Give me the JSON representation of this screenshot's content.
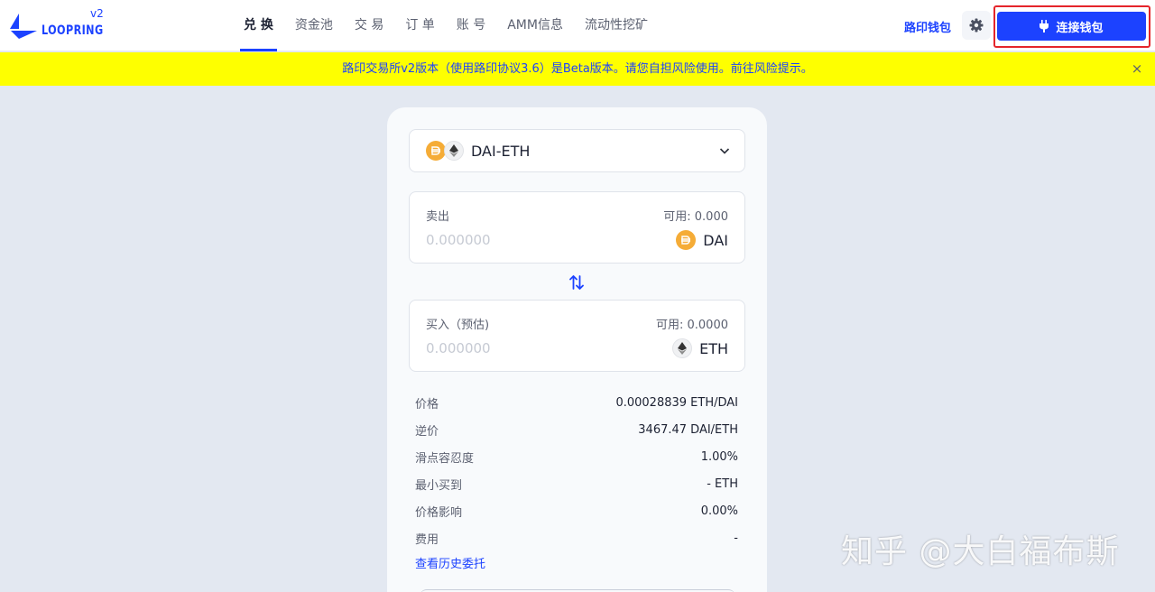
{
  "header": {
    "logo_text": "LOOPRING",
    "version": "v2",
    "nav": [
      {
        "label": "兑 换",
        "active": true
      },
      {
        "label": "资金池",
        "active": false
      },
      {
        "label": "交 易",
        "active": false
      },
      {
        "label": "订 单",
        "active": false
      },
      {
        "label": "账 号",
        "active": false
      },
      {
        "label": "AMM信息",
        "active": false
      },
      {
        "label": "流动性挖矿",
        "active": false
      }
    ],
    "wallet_link": "路印钱包",
    "settings_icon": "gear-icon",
    "connect_button": "连接钱包",
    "connect_icon": "plug-icon"
  },
  "banner": {
    "text": "路印交易所v2版本（使用路印协议3.6）是Beta版本。请您自担风险使用。前往风险提示。",
    "close": "×"
  },
  "swap": {
    "pair": "DAI-ETH",
    "sell": {
      "label": "卖出",
      "available": "可用: 0.000",
      "amount_placeholder": "0.000000",
      "token": "DAI"
    },
    "buy": {
      "label": "买入（预估)",
      "available": "可用: 0.0000",
      "amount_placeholder": "0.000000",
      "token": "ETH"
    },
    "details": [
      {
        "key": "价格",
        "value": "0.00028839 ETH/DAI"
      },
      {
        "key": "逆价",
        "value": "3467.47 DAI/ETH"
      },
      {
        "key": "滑点容忍度",
        "value": "1.00%"
      },
      {
        "key": "最小买到",
        "value": "- ETH"
      },
      {
        "key": "价格影响",
        "value": "0.00%"
      },
      {
        "key": "费用",
        "value": "-"
      }
    ],
    "history_link": "查看历史委托"
  },
  "watermark": "知乎 @大白福布斯",
  "colors": {
    "accent": "#1c42ff",
    "banner_bg": "#feff00",
    "page_bg": "#e3e8f1",
    "highlight": "#e5252b"
  }
}
